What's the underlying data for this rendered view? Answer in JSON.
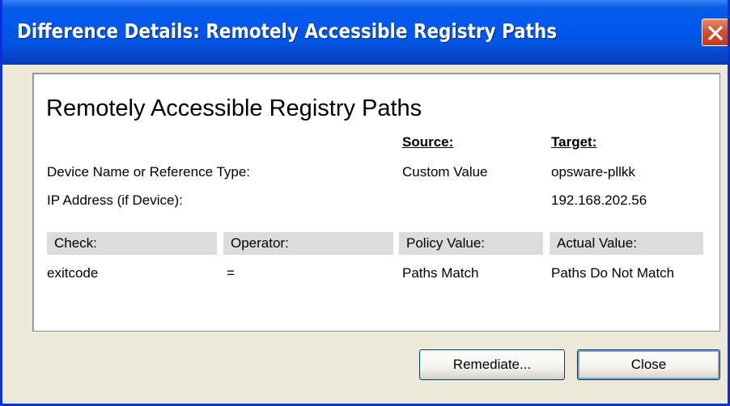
{
  "window": {
    "title": "Difference Details: Remotely Accessible Registry Paths",
    "close_icon": "close-icon"
  },
  "details": {
    "heading": "Remotely Accessible Registry Paths",
    "source_header": "Source:",
    "target_header": "Target:",
    "rows": [
      {
        "label": "Device Name or Reference Type:",
        "source": "Custom Value",
        "target": "opsware-pllkk"
      },
      {
        "label": "IP Address (if Device):",
        "source": "",
        "target": "192.168.202.56"
      }
    ]
  },
  "table": {
    "columns": [
      "Check:",
      "Operator:",
      "Policy Value:",
      "Actual Value:"
    ],
    "rows": [
      [
        "exitcode",
        "=",
        "Paths Match",
        "Paths Do Not Match"
      ]
    ]
  },
  "buttons": {
    "remediate": "Remediate...",
    "close": "Close"
  },
  "colors": {
    "titlebar": "#0058EE",
    "close_button": "#D2542F",
    "dialog_background": "#ECE9D8",
    "table_header_bg": "#DCDCDC"
  }
}
